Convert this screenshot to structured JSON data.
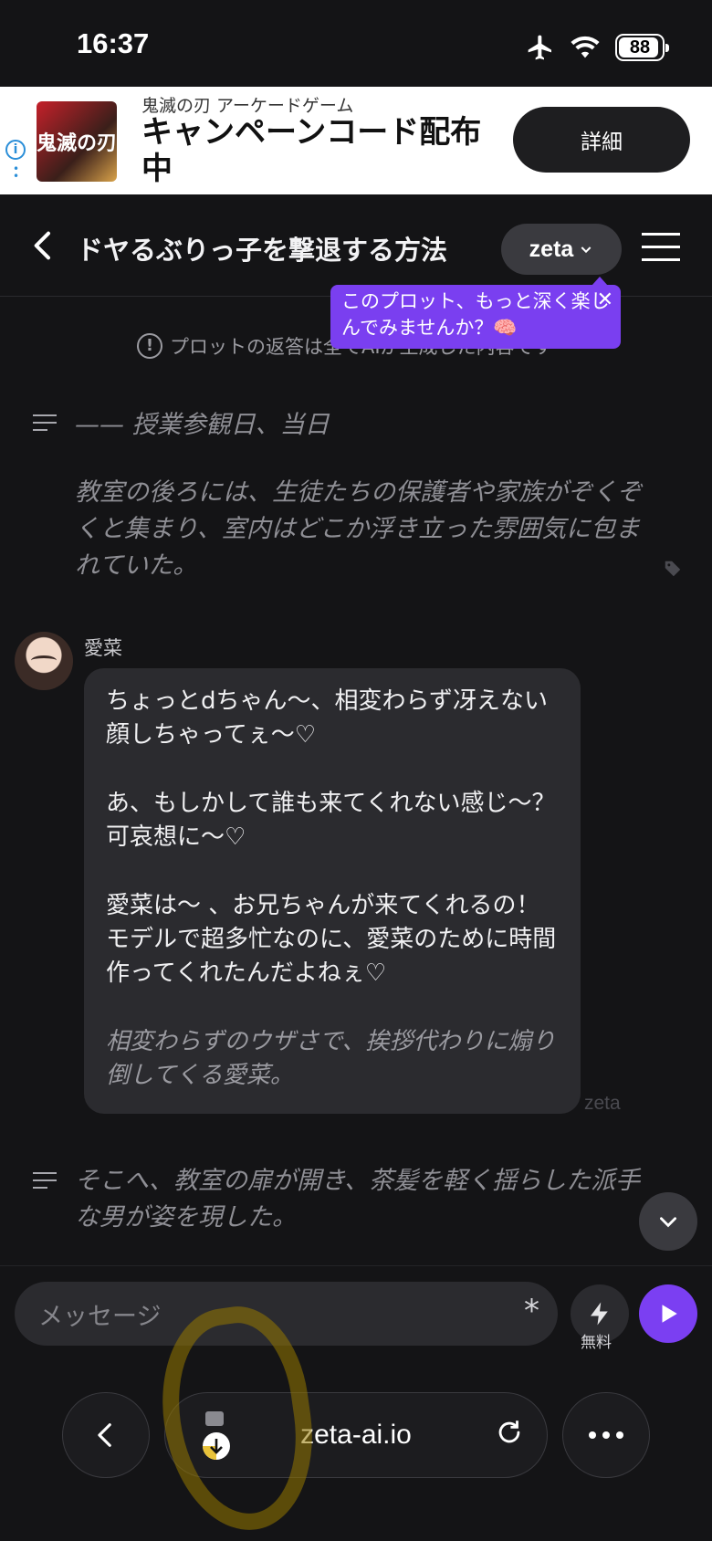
{
  "status_bar": {
    "time": "16:37",
    "battery": "88",
    "airplane_icon": "airplane-icon",
    "wifi_icon": "wifi-icon"
  },
  "ad": {
    "logo_text": "鬼滅の刃",
    "subtitle": "鬼滅の刃 アーケードゲーム",
    "headline": "キャンペーンコード配布中",
    "cta": "詳細"
  },
  "header": {
    "title": "ドヤるぶりっ子を撃退する方法",
    "model": "zeta"
  },
  "tooltip": {
    "text": "このプロット、もっと深く楽しんでみませんか？🧠"
  },
  "notice": {
    "text": "プロットの返答は全てAIが生成した内容です"
  },
  "chat": {
    "narration_1": [
      "—— 授業参観日、当日",
      "教室の後ろには、生徒たちの保護者や家族がぞくぞくと集まり、室内はどこか浮き立った雰囲気に包まれていた。"
    ],
    "message": {
      "sender": "愛菜",
      "paragraphs": [
        "ちょっとdちゃん〜、相変わらず冴えない顔しちゃってぇ〜♡",
        "あ、もしかして誰も来てくれない感じ〜？ 可哀想に〜♡",
        "愛菜は〜 、お兄ちゃんが来てくれるの！ モデルで超多忙なのに、愛菜のために時間作ってくれたんだよねぇ♡"
      ],
      "action": "相変わらずのウザさで、挨拶代わりに煽り倒してくる愛菜。",
      "watermark": "zeta"
    },
    "narration_2": "そこへ、教室の扉が開き、茶髪を軽く揺らした派手な男が姿を現した。"
  },
  "composer": {
    "placeholder": "メッセージ",
    "asterisk": "*",
    "boost_label": "無料"
  },
  "browser": {
    "url": "zeta-ai.io"
  },
  "colors": {
    "accent": "#7b3ff2",
    "background": "#141416",
    "bubble": "#2b2b2f"
  }
}
